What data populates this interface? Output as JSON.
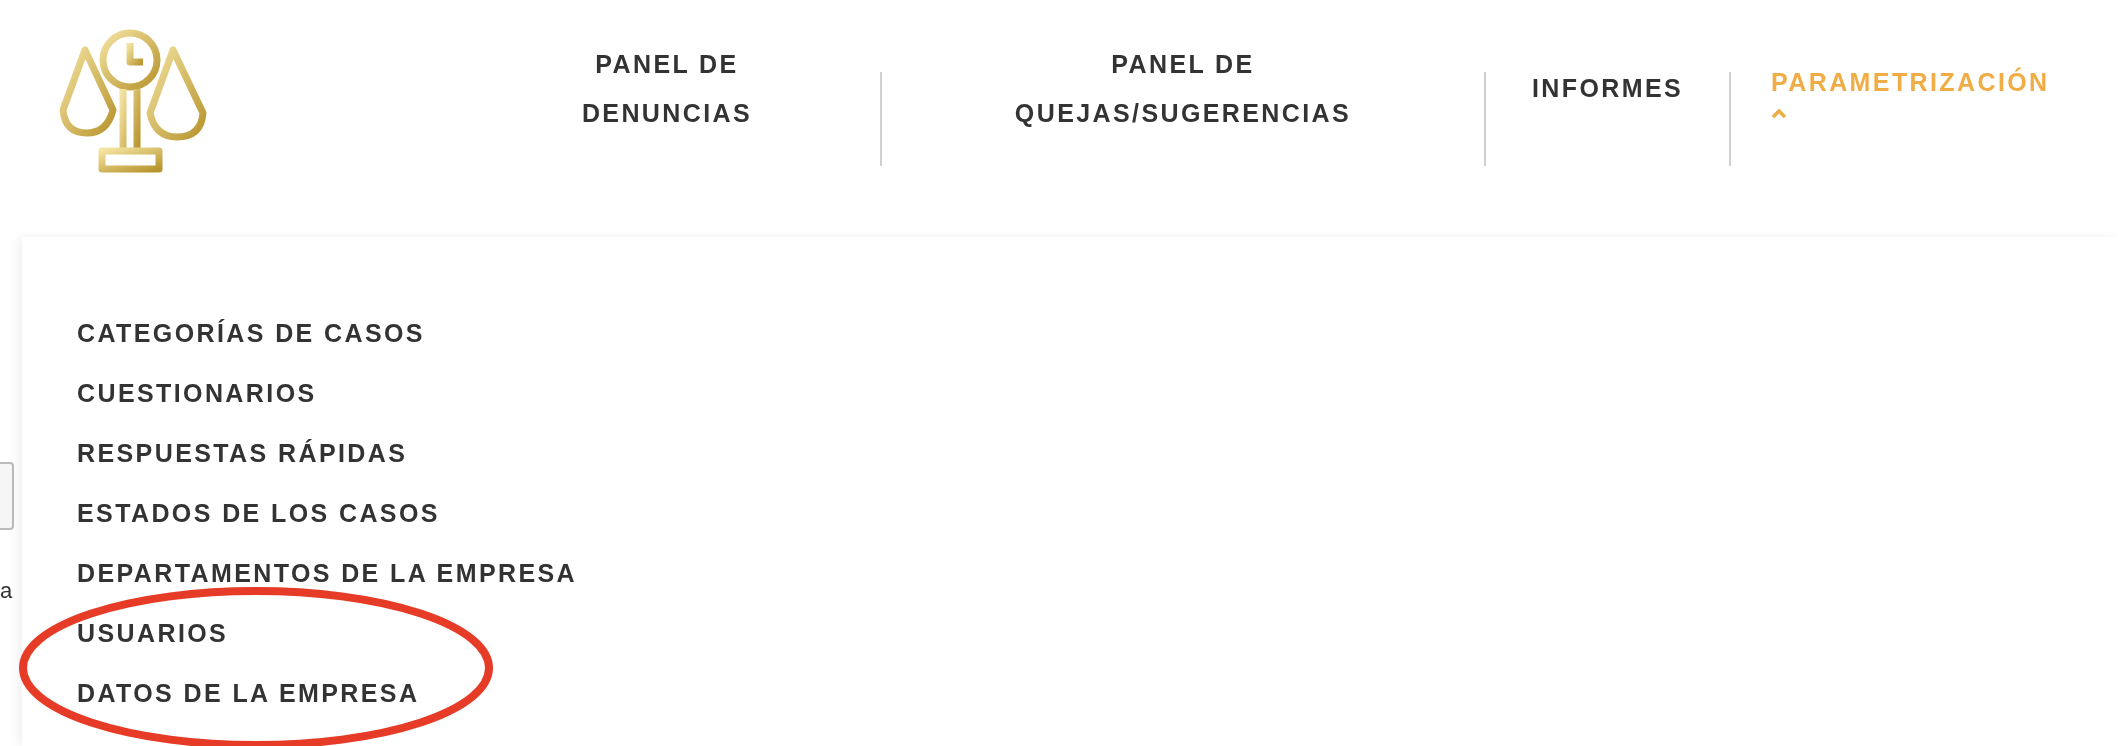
{
  "nav": {
    "items": [
      {
        "label": "PANEL DE DENUNCIAS",
        "selected": false,
        "expanded": false
      },
      {
        "label": "PANEL DE QUEJAS/SUGERENCIAS",
        "selected": false,
        "expanded": false
      },
      {
        "label": "INFORMES",
        "selected": false,
        "expanded": false
      },
      {
        "label": "PARAMETRIZACIÓN",
        "selected": true,
        "expanded": true
      }
    ]
  },
  "dropdown": {
    "items": [
      {
        "label": "CATEGORÍAS DE CASOS"
      },
      {
        "label": "CUESTIONARIOS"
      },
      {
        "label": "RESPUESTAS RÁPIDAS"
      },
      {
        "label": "ESTADOS DE LOS CASOS"
      },
      {
        "label": "DEPARTAMENTOS DE LA EMPRESA"
      },
      {
        "label": "USUARIOS"
      },
      {
        "label": "DATOS DE LA EMPRESA"
      }
    ]
  },
  "background": {
    "text": "a"
  }
}
